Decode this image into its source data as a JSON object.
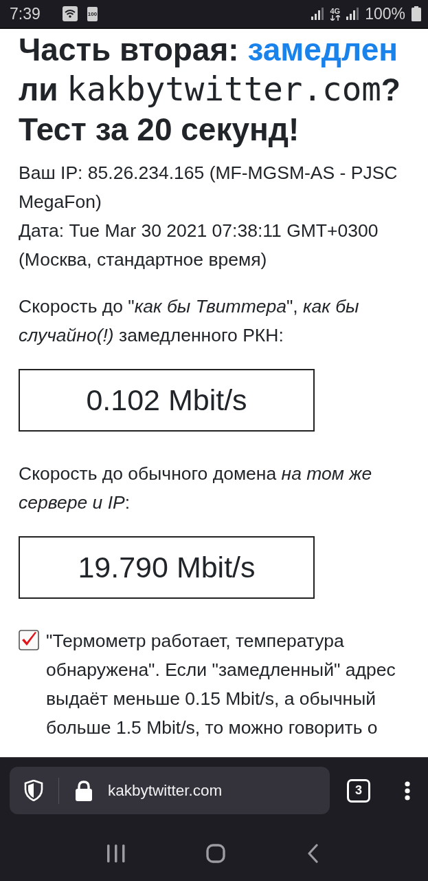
{
  "status_bar": {
    "time": "7:39",
    "notification_badge": "100",
    "network_type": "4G",
    "battery": "100%"
  },
  "article": {
    "heading": [
      {
        "kind": "plain",
        "text": "Часть вторая: "
      },
      {
        "kind": "link",
        "text": "замедлен"
      },
      {
        "kind": "plain",
        "text": " ли "
      },
      {
        "kind": "code",
        "text": "kakbytwitter.com"
      },
      {
        "kind": "plain",
        "text": "? Тест за 20 секунд!"
      }
    ],
    "blocks": [
      {
        "kind": "lines",
        "lines": [
          "Ваш IP: 85.26.234.165 (MF-MGSM-AS - PJSC MegaFon)",
          "Дата: Tue Mar 30 2021 07:38:11 GMT+0300 (Москва, стандартное время)"
        ]
      },
      {
        "kind": "paragraph",
        "text": "Скорость до \"*как бы Твиттера*\", *как бы случайно(!)* замедленного РКН:"
      },
      {
        "kind": "result",
        "text": "0.102 Mbit/s"
      },
      {
        "kind": "paragraph",
        "text": "Скорость до обычного домена *на том же сервере и IP*:"
      },
      {
        "kind": "result",
        "text": "19.790 Mbit/s"
      },
      {
        "kind": "checked",
        "text": "\"Термометр работает, температура обнаружена\". Если \"замедленный\" адрес выдаёт меньше 0.15 Mbit/s, а обычный больше 1.5 Mbit/s, то можно говорить о"
      }
    ]
  },
  "browser_bar": {
    "url": "kakbytwitter.com",
    "tab_count": "3"
  }
}
